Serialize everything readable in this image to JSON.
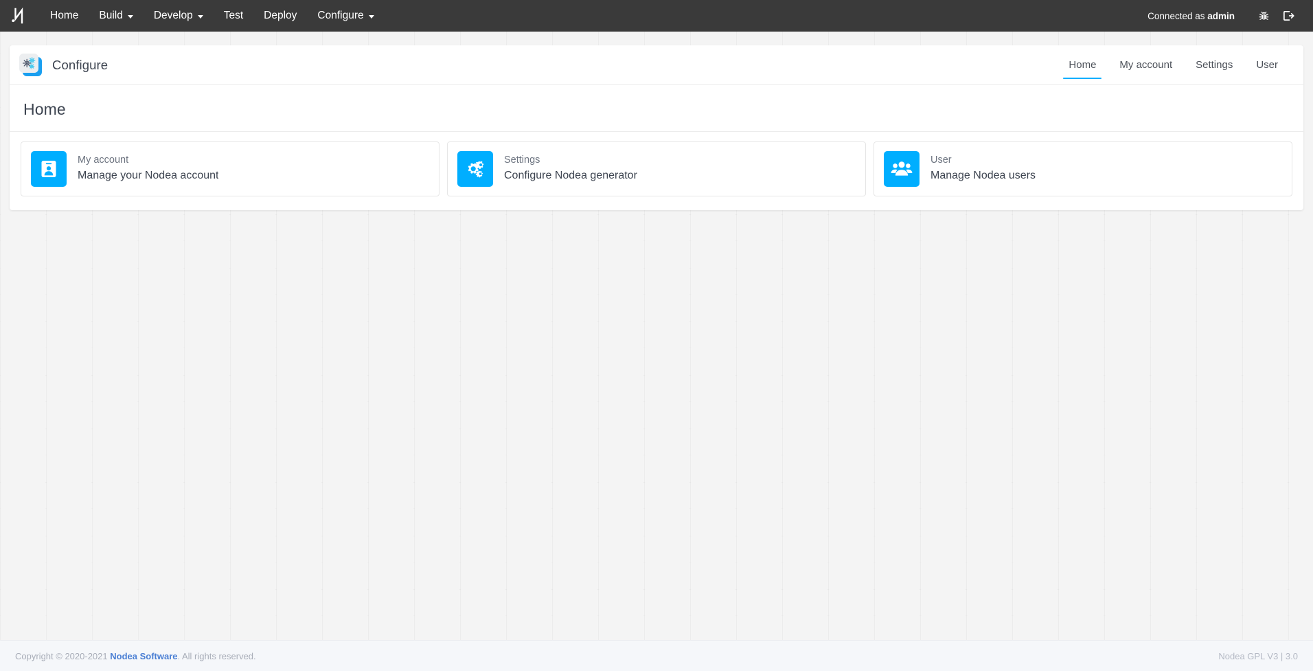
{
  "navbar": {
    "logo_icon": "nodea-n-logo-icon",
    "links": [
      {
        "label": "Home",
        "has_caret": false
      },
      {
        "label": "Build",
        "has_caret": true
      },
      {
        "label": "Develop",
        "has_caret": true
      },
      {
        "label": "Test",
        "has_caret": false
      },
      {
        "label": "Deploy",
        "has_caret": false
      },
      {
        "label": "Configure",
        "has_caret": true
      }
    ],
    "connected_prefix": "Connected as ",
    "connected_user": "admin",
    "bug_icon": "bug-icon",
    "logout_icon": "logout-icon"
  },
  "panel": {
    "app_logo_icon": "gears-icon",
    "app_title": "Configure",
    "tabs": [
      {
        "label": "Home",
        "active": true
      },
      {
        "label": "My account",
        "active": false
      },
      {
        "label": "Settings",
        "active": false
      },
      {
        "label": "User",
        "active": false
      }
    ],
    "page_title": "Home",
    "cards": [
      {
        "label": "My account",
        "description": "Manage your Nodea account",
        "icon": "id-badge-icon"
      },
      {
        "label": "Settings",
        "description": "Configure Nodea generator",
        "icon": "cogs-icon"
      },
      {
        "label": "User",
        "description": "Manage Nodea users",
        "icon": "users-icon"
      }
    ]
  },
  "footer": {
    "copyright_prefix": "Copyright © 2020-2021 ",
    "company_link": "Nodea Software",
    "copyright_suffix": ". All rights reserved.",
    "version": "Nodea GPL V3 | 3.0"
  },
  "colors": {
    "accent": "#00aeff",
    "navbar_bg": "#3a3a3a",
    "panel_bg": "#ffffff",
    "footer_link": "#4a7fd4",
    "page_bg": "#f4f4f4"
  }
}
